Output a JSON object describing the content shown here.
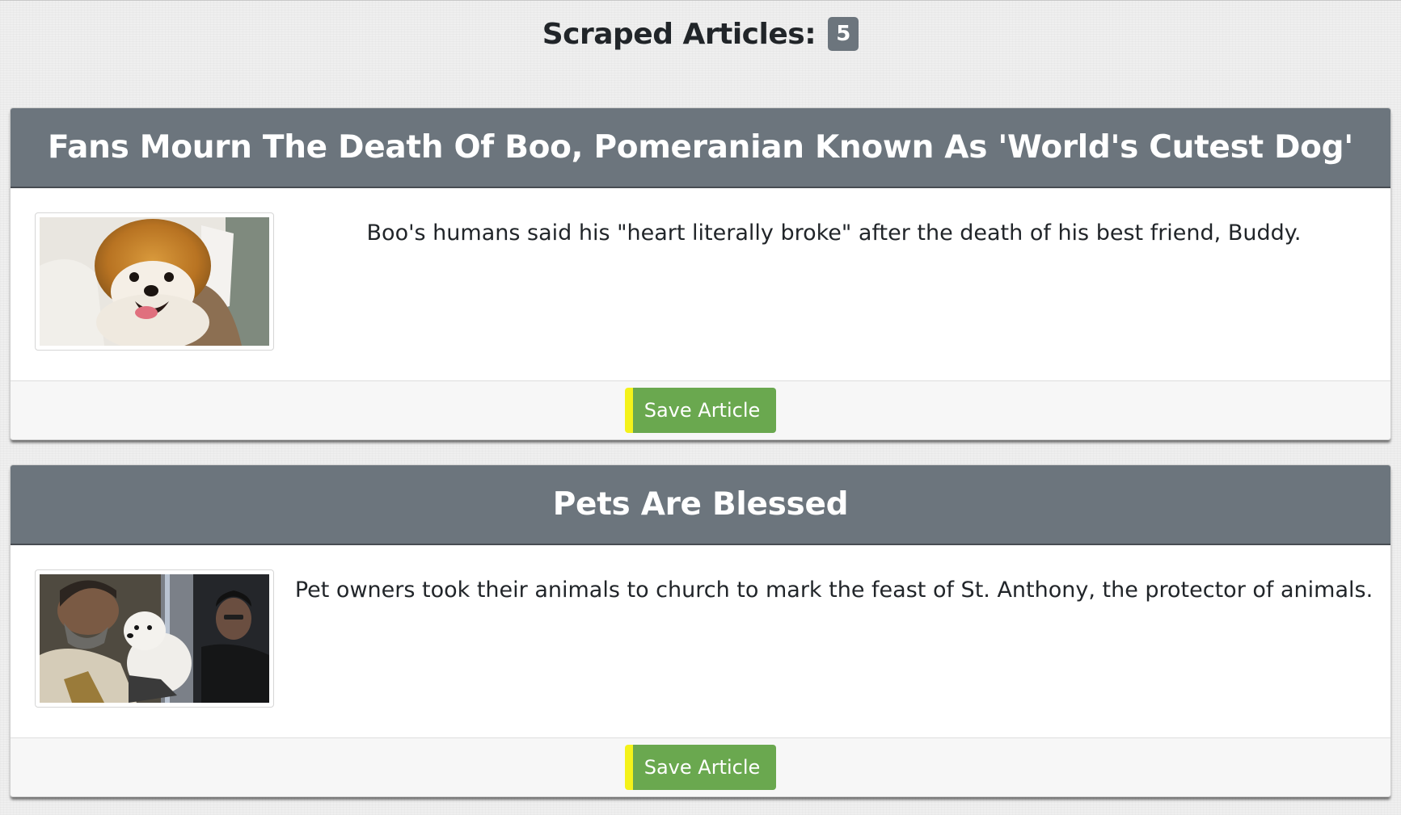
{
  "header": {
    "title": "Scraped Articles:",
    "count": "5"
  },
  "articles": [
    {
      "title": "Fans Mourn The Death Of Boo, Pomeranian Known As 'World's Cutest Dog'",
      "summary": "Boo's humans said his \"heart literally broke\" after the death of his best friend, Buddy.",
      "image": "pomeranian-dog-photo",
      "save_label": "Save Article"
    },
    {
      "title": "Pets Are Blessed",
      "summary": "Pet owners took their animals to church to mark the feast of St. Anthony, the protector of animals.",
      "image": "priest-blessing-dog-photo",
      "save_label": "Save Article"
    }
  ],
  "colors": {
    "card_header": "#6c757d",
    "save_button": "#6aa84f",
    "save_button_accent": "#f4f21a",
    "badge": "#6c757d"
  }
}
